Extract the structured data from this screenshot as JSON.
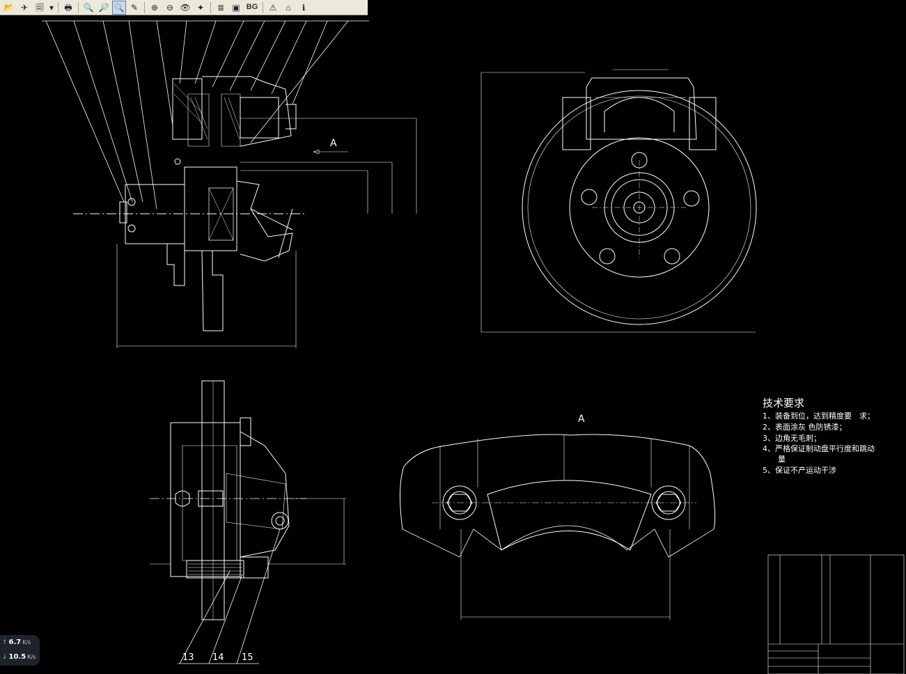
{
  "toolbar": {
    "buttons": [
      {
        "name": "open-icon",
        "glyph": "📂"
      },
      {
        "name": "pin-icon",
        "glyph": "✈"
      },
      {
        "name": "layers-icon",
        "glyph": "🗐"
      },
      {
        "name": "dropdown-icon",
        "glyph": "▾"
      },
      {
        "name": "print-icon",
        "glyph": "🖶"
      },
      {
        "name": "zoom-out-icon",
        "glyph": "🔍"
      },
      {
        "name": "zoom-in-icon",
        "glyph": "🔎"
      },
      {
        "name": "zoom-window-icon",
        "glyph": "🔍"
      },
      {
        "name": "pan-icon",
        "glyph": "✎"
      },
      {
        "name": "zoom-extents-icon",
        "glyph": "⊕"
      },
      {
        "name": "zoom-previous-icon",
        "glyph": "⊖"
      },
      {
        "name": "eye-icon",
        "glyph": "👁"
      },
      {
        "name": "rotate-icon",
        "glyph": "✦"
      },
      {
        "name": "layer-icon",
        "glyph": "≣"
      },
      {
        "name": "window-icon",
        "glyph": "▣"
      },
      {
        "name": "background-icon",
        "glyph": "BG"
      },
      {
        "name": "warning-icon",
        "glyph": "⚠"
      },
      {
        "name": "home-icon",
        "glyph": "⌂"
      },
      {
        "name": "info-icon",
        "glyph": "ℹ"
      }
    ]
  },
  "drawing": {
    "view_label_a1": "A",
    "view_label_a2": "A",
    "part_numbers": [
      "13",
      "14",
      "15"
    ],
    "tech_title": "技术要求",
    "tech_items": [
      "1、装备到位，达到精度要　求；",
      "2、表面涂灰 色防锈漆；",
      "3、边角无毛刺；",
      "4、严格保证制动盘平行度和跳动",
      "　　量",
      "5、保证不产运动干涉"
    ]
  },
  "network": {
    "upload": "6.7",
    "download": "10.5",
    "unit": "K/s"
  },
  "colors": {
    "background": "#000000",
    "lines": "#ffffff",
    "toolbar": "#ece9d8"
  }
}
